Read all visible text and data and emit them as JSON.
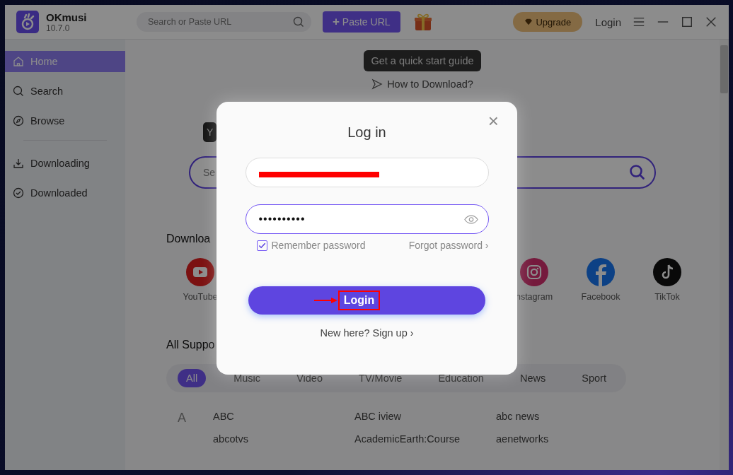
{
  "app": {
    "name": "OKmusi",
    "version": "10.7.0"
  },
  "topbar": {
    "search_placeholder": "Search or Paste URL",
    "paste_button": "Paste URL",
    "paste_icon": "+",
    "upgrade": "Upgrade",
    "login": "Login"
  },
  "sidebar": {
    "items": [
      {
        "label": "Home",
        "selected": true
      },
      {
        "label": "Search",
        "selected": false
      },
      {
        "label": "Browse",
        "selected": false
      },
      {
        "label": "Downloading",
        "selected": false
      },
      {
        "label": "Downloaded",
        "selected": false
      }
    ]
  },
  "main": {
    "guide_tooltip": "Get a quick start guide",
    "how_to": "How to Download?",
    "small_tooltip": "Y",
    "search_placeholder": "Se",
    "download_heading": "Downloa",
    "platforms": [
      {
        "label": "YouTube"
      },
      {
        "label": "nstagram"
      },
      {
        "label": "Facebook"
      },
      {
        "label": "TikTok"
      }
    ],
    "supported_heading": "All Suppo",
    "categories": [
      {
        "label": "All",
        "selected": true
      },
      {
        "label": "Music",
        "selected": false
      },
      {
        "label": "Video",
        "selected": false
      },
      {
        "label": "TV/Movie",
        "selected": false
      },
      {
        "label": "Education",
        "selected": false
      },
      {
        "label": "News",
        "selected": false
      },
      {
        "label": "Sport",
        "selected": false
      }
    ],
    "letter": "A",
    "sites": [
      "ABC",
      "ABC iview",
      "abc news",
      "abcotvs",
      "AcademicEarth:Course",
      "aenetworks"
    ]
  },
  "login_dialog": {
    "title": "Log in",
    "close": "×",
    "password_value": "••••••••••",
    "remember": {
      "label": "Remember password",
      "checked": true
    },
    "forgot": "Forgot password ›",
    "button": "Login",
    "signup": "New here? Sign up ›"
  }
}
